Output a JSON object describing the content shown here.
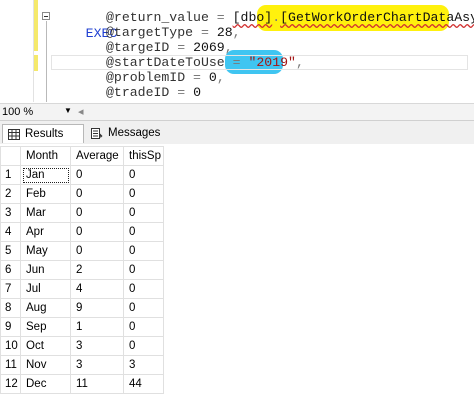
{
  "editor": {
    "keyword": "EXEC",
    "return_var": "@return_value",
    "equals": " = ",
    "schema": "[dbo]",
    "dot": ".",
    "proc": "[GetWorkOrderChartDataAsync]",
    "params": [
      {
        "name": "@targetType",
        "value": "28",
        "sep": ","
      },
      {
        "name": "@targeID",
        "value": "2069",
        "sep": ","
      },
      {
        "name": "@startDateToUse",
        "value": "\"2019\"",
        "sep": ","
      },
      {
        "name": "@problemID",
        "value": "0",
        "sep": ","
      },
      {
        "name": "@tradeID",
        "value": "0",
        "sep": ""
      }
    ],
    "highlight_colors": {
      "procedure": "#fff000",
      "date_param": "#35c2f0"
    }
  },
  "zoom": {
    "label": "100 %"
  },
  "tabs": [
    {
      "label": "Results",
      "icon": "grid-icon",
      "active": true
    },
    {
      "label": "Messages",
      "icon": "messages-icon",
      "active": false
    }
  ],
  "results": {
    "columns": [
      "Month",
      "Average",
      "thisSp"
    ],
    "rows": [
      {
        "n": "1",
        "month": "Jan",
        "average": "0",
        "thisSp": "0"
      },
      {
        "n": "2",
        "month": "Feb",
        "average": "0",
        "thisSp": "0"
      },
      {
        "n": "3",
        "month": "Mar",
        "average": "0",
        "thisSp": "0"
      },
      {
        "n": "4",
        "month": "Apr",
        "average": "0",
        "thisSp": "0"
      },
      {
        "n": "5",
        "month": "May",
        "average": "0",
        "thisSp": "0"
      },
      {
        "n": "6",
        "month": "Jun",
        "average": "2",
        "thisSp": "0"
      },
      {
        "n": "7",
        "month": "Jul",
        "average": "4",
        "thisSp": "0"
      },
      {
        "n": "8",
        "month": "Aug",
        "average": "9",
        "thisSp": "0"
      },
      {
        "n": "9",
        "month": "Sep",
        "average": "1",
        "thisSp": "0"
      },
      {
        "n": "10",
        "month": "Oct",
        "average": "3",
        "thisSp": "0"
      },
      {
        "n": "11",
        "month": "Nov",
        "average": "3",
        "thisSp": "3"
      },
      {
        "n": "12",
        "month": "Dec",
        "average": "11",
        "thisSp": "44"
      }
    ]
  }
}
